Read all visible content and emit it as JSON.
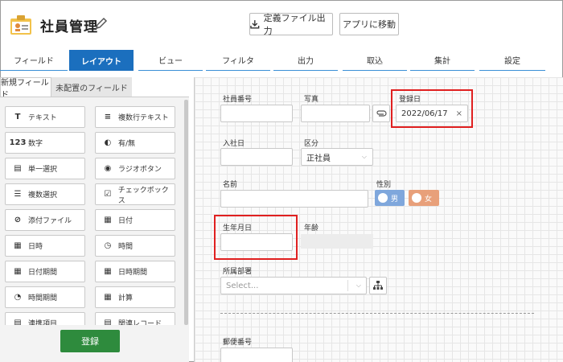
{
  "header": {
    "title": "社員管理",
    "export_label": "定義ファイル出力",
    "move_label": "アプリに移動"
  },
  "tabs": [
    "フィールド",
    "レイアウト",
    "ビュー",
    "フィルタ",
    "出力",
    "取込",
    "集計",
    "設定"
  ],
  "active_tab": "レイアウト",
  "left_panel": {
    "tabs": [
      "新規フィールド",
      "未配置のフィールド"
    ],
    "fields": [
      {
        "label": "テキスト",
        "icon": "text-icon",
        "glyph": "T"
      },
      {
        "label": "複数行テキスト",
        "icon": "multiline-icon",
        "glyph": "≡"
      },
      {
        "label": "数字",
        "icon": "number-icon",
        "glyph": "123"
      },
      {
        "label": "有/無",
        "icon": "toggle-icon",
        "glyph": "◐"
      },
      {
        "label": "単一選択",
        "icon": "single-select-icon",
        "glyph": "▤"
      },
      {
        "label": "ラジオボタン",
        "icon": "radio-icon",
        "glyph": "◉"
      },
      {
        "label": "複数選択",
        "icon": "multi-select-icon",
        "glyph": "☰"
      },
      {
        "label": "チェックボックス",
        "icon": "checkbox-icon",
        "glyph": "☑"
      },
      {
        "label": "添付ファイル",
        "icon": "attachment-icon",
        "glyph": "⊘"
      },
      {
        "label": "日付",
        "icon": "calendar-icon",
        "glyph": "▦"
      },
      {
        "label": "日時",
        "icon": "datetime-icon",
        "glyph": "▦"
      },
      {
        "label": "時間",
        "icon": "clock-icon",
        "glyph": "◷"
      },
      {
        "label": "日付期間",
        "icon": "date-range-icon",
        "glyph": "▦"
      },
      {
        "label": "日時期間",
        "icon": "datetime-range-icon",
        "glyph": "▦"
      },
      {
        "label": "時間期間",
        "icon": "time-range-icon",
        "glyph": "◔"
      },
      {
        "label": "計算",
        "icon": "calculator-icon",
        "glyph": "▦"
      },
      {
        "label": "連携項目",
        "icon": "link-field-icon",
        "glyph": "▤"
      },
      {
        "label": "関連レコード",
        "icon": "related-record-icon",
        "glyph": "▤"
      }
    ],
    "register_label": "登録"
  },
  "form": {
    "employee_no_label": "社員番号",
    "photo_label": "写真",
    "reg_date_label": "登録日",
    "reg_date_value": "2022/06/17",
    "join_date_label": "入社日",
    "category_label": "区分",
    "category_value": "正社員",
    "name_label": "名前",
    "gender_label": "性別",
    "gender_male": "男",
    "gender_female": "女",
    "birthday_label": "生年月日",
    "age_label": "年齢",
    "dept_label": "所属部署",
    "dept_placeholder": "Select...",
    "zip_label": "郵便番号"
  },
  "colors": {
    "accent": "#1b6fbe",
    "register": "#2e8b3d",
    "highlight": "#e02020",
    "male": "#7fa7dc",
    "female": "#e8a07a"
  }
}
